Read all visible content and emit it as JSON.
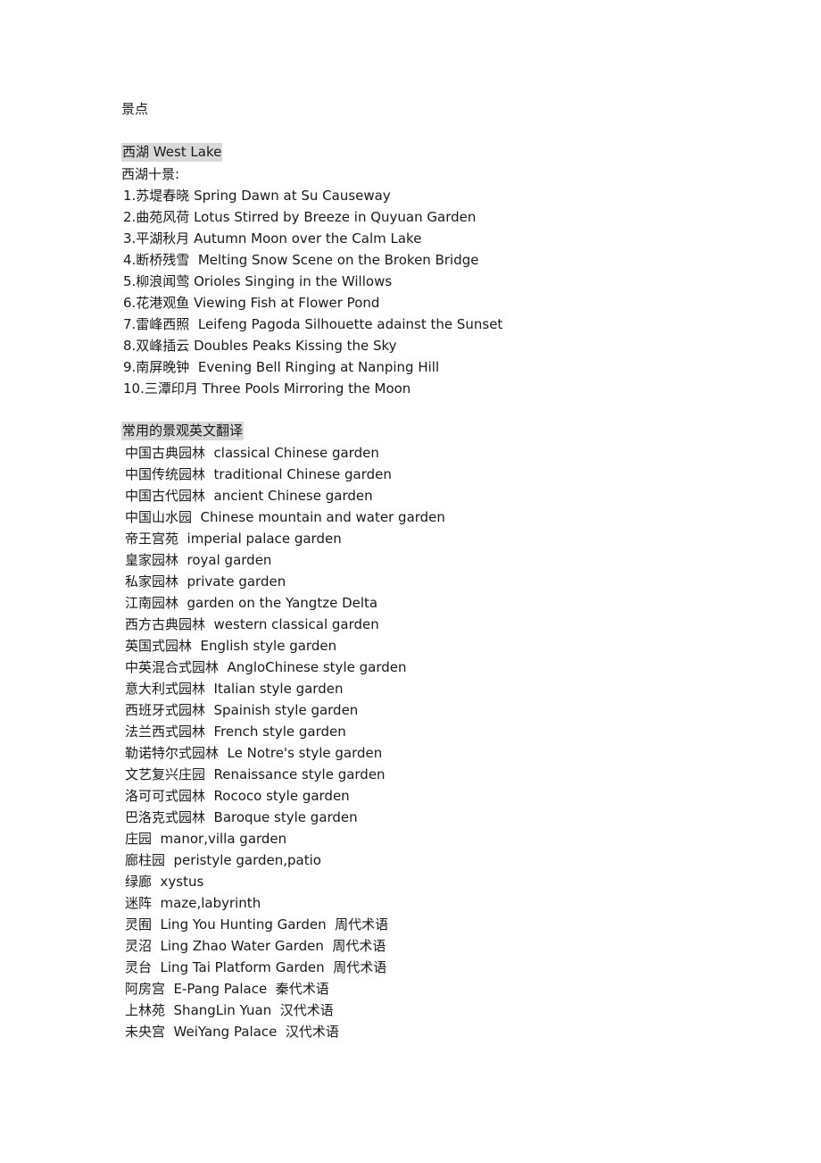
{
  "document": {
    "title": "景点",
    "sections": [
      {
        "heading": "西湖 West Lake",
        "subheading": "西湖十景:",
        "items": [
          "1.苏堤春晓 Spring Dawn at Su Causeway",
          "2.曲苑风荷 Lotus Stirred by Breeze in Quyuan Garden",
          "3.平湖秋月 Autumn Moon over the Calm Lake",
          "4.断桥残雪  Melting Snow Scene on the Broken Bridge",
          "5.柳浪闻莺 Orioles Singing in the Willows",
          "6.花港观鱼 Viewing Fish at Flower Pond",
          "7.雷峰西照  Leifeng Pagoda Silhouette adainst the Sunset",
          "8.双峰插云 Doubles Peaks Kissing the Sky",
          "9.南屏晚钟  Evening Bell Ringing at Nanping Hill",
          "10.三潭印月 Three Pools Mirroring the Moon"
        ]
      },
      {
        "heading": "常用的景观英文翻译",
        "items": [
          "中国古典园林  classical Chinese garden",
          "中国传统园林  traditional Chinese garden",
          "中国古代园林  ancient Chinese garden",
          "中国山水园  Chinese mountain and water garden",
          "帝王宫苑  imperial palace garden",
          "皇家园林  royal garden",
          "私家园林  private garden",
          "江南园林  garden on the Yangtze Delta",
          "西方古典园林  western classical garden",
          "英国式园林  English style garden",
          "中英混合式园林  AngloChinese style garden",
          "意大利式园林  Italian style garden",
          "西班牙式园林  Spainish style garden",
          "法兰西式园林  French style garden",
          "勒诺特尔式园林  Le Notre's style garden",
          "文艺复兴庄园  Renaissance style garden",
          "洛可可式园林  Rococo style garden",
          "巴洛克式园林  Baroque style garden",
          "庄园  manor,villa garden",
          "廊柱园  peristyle garden,patio",
          "绿廊  xystus",
          "迷阵  maze,labyrinth",
          "灵囿  Ling You Hunting Garden  周代术语",
          "灵沼  Ling Zhao Water Garden  周代术语",
          "灵台  Ling Tai Platform Garden  周代术语",
          "阿房宫  E-Pang Palace  秦代术语",
          "上林苑  ShangLin Yuan  汉代术语",
          "未央宫  WeiYang Palace  汉代术语"
        ]
      }
    ]
  },
  "colors": {
    "page_background": "#ffffff",
    "text": "#1a1a1a",
    "highlight": "#d9d9d9"
  }
}
